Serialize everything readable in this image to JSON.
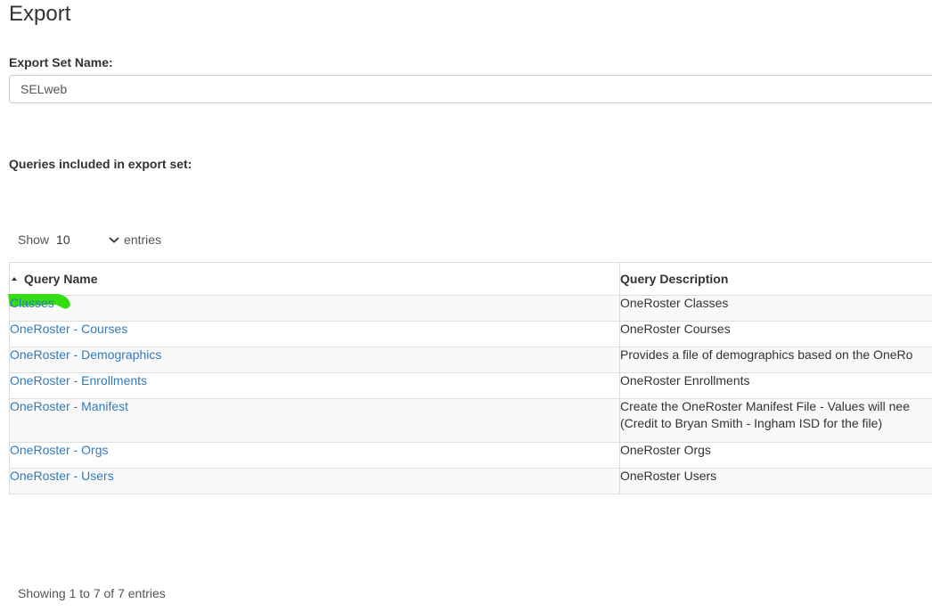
{
  "page": {
    "title": "Export"
  },
  "export_set": {
    "label": "Export Set Name:",
    "value": "SELweb"
  },
  "queries": {
    "label": "Queries included in export set:"
  },
  "length": {
    "show": "Show",
    "value": "10",
    "entries": "entries"
  },
  "table": {
    "headers": {
      "name": "Query Name",
      "description": "Query Description"
    },
    "rows": [
      {
        "name": "Classes",
        "description": "OneRoster Classes",
        "highlight": true
      },
      {
        "name": "OneRoster - Courses",
        "description": "OneRoster Courses"
      },
      {
        "name": "OneRoster - Demographics",
        "description": "Provides a file of demographics based on the OneRo"
      },
      {
        "name": "OneRoster - Enrollments",
        "description": "OneRoster Enrollments"
      },
      {
        "name": "OneRoster - Manifest",
        "description": "Create the OneRoster Manifest File - Values will nee",
        "description_line2": "(Credit to Bryan Smith - Ingham ISD for the file)"
      },
      {
        "name": "OneRoster - Orgs",
        "description": "OneRoster Orgs"
      },
      {
        "name": "OneRoster - Users",
        "description": "OneRoster Users"
      }
    ]
  },
  "info": "Showing 1 to 7 of 7 entries",
  "colors": {
    "link": "#337ab7",
    "highlight": "#33dd11",
    "border": "#dddddd",
    "stripe": "#f9f9f9"
  },
  "icons": {
    "sort": "sort-asc-icon",
    "dropdown": "chevron-down-icon"
  }
}
